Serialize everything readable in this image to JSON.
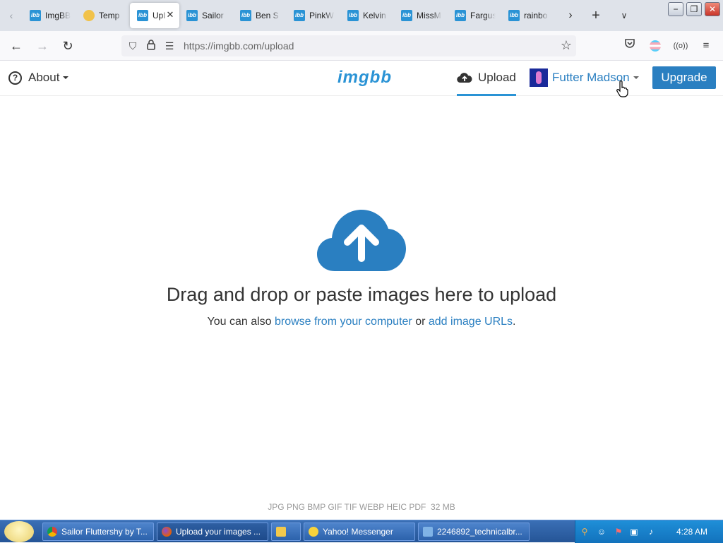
{
  "browser": {
    "tabs": [
      {
        "label": "ImgBB",
        "icon": "imgbb-favicon",
        "active": false
      },
      {
        "label": "Temp",
        "icon": "emoji-favicon",
        "active": false
      },
      {
        "label": "Upl",
        "icon": "imgbb-favicon",
        "active": true
      },
      {
        "label": "Sailor",
        "icon": "imgbb-favicon",
        "active": false
      },
      {
        "label": "Ben S",
        "icon": "imgbb-favicon",
        "active": false
      },
      {
        "label": "PinkW",
        "icon": "imgbb-favicon",
        "active": false
      },
      {
        "label": "Kelvin",
        "icon": "imgbb-favicon",
        "active": false
      },
      {
        "label": "MissM",
        "icon": "imgbb-favicon",
        "active": false
      },
      {
        "label": "Fargus",
        "icon": "imgbb-favicon",
        "active": false
      },
      {
        "label": "rainbo",
        "icon": "imgbb-favicon",
        "active": false
      }
    ],
    "favicon_text": "ibb",
    "url": "https://imgbb.com/upload"
  },
  "site": {
    "about_label": "About",
    "logo": "imgbb",
    "upload_label": "Upload",
    "user_name": "Futter Madson",
    "upgrade_label": "Upgrade",
    "accent_color": "#2a93d5",
    "link_color": "#2a7fc1"
  },
  "main": {
    "headline": "Drag and drop or paste images here to upload",
    "sub_prefix": "You can also",
    "browse_link": "browse from your computer",
    "sub_or": "or",
    "url_link": "add image URLs",
    "sub_suffix": ".",
    "formats": "JPG PNG BMP GIF TIF WEBP HEIC PDF",
    "max_size": "32 MB"
  },
  "taskbar": {
    "items": [
      {
        "label": "Sailor Fluttershy by T...",
        "icon": "chrome-icon"
      },
      {
        "label": "Upload your images ...",
        "icon": "firefox-icon"
      },
      {
        "label": "",
        "icon": "folder-icon"
      },
      {
        "label": "Yahoo! Messenger",
        "icon": "yahoo-messenger-icon"
      },
      {
        "label": "2246892_technicalbr...",
        "icon": "image-viewer-icon"
      }
    ],
    "clock": "4:28 AM"
  }
}
